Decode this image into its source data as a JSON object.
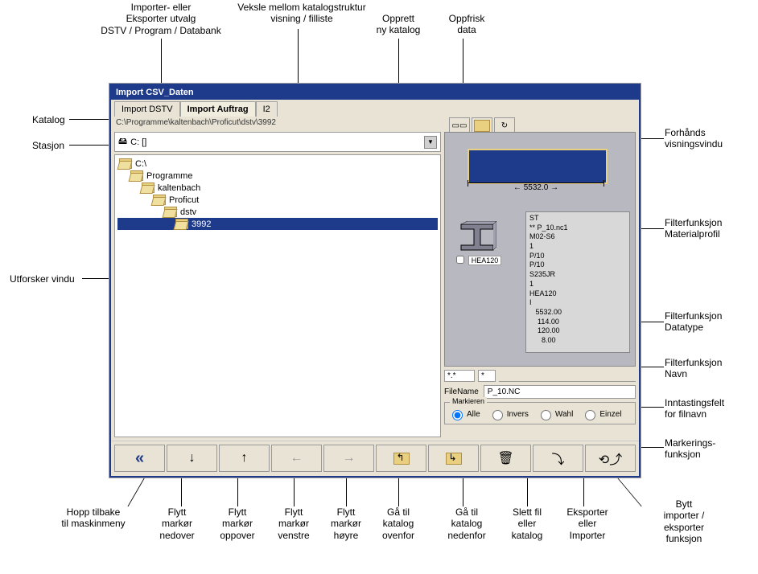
{
  "annotations": {
    "import_export": "Importer- eller\nEksporter utvalg\nDSTV / Program / Databank",
    "toggle_view": "Veksle mellom katalogstruktur\nvisning / filliste",
    "new_catalog": "Opprett\nny katalog",
    "refresh": "Oppfrisk\ndata",
    "katalog": "Katalog",
    "stasjon": "Stasjon",
    "explorer": "Utforsker vindu",
    "preview_window": "Forhånds\nvisningsvindu",
    "filter_material": "Filterfunksjon\nMaterialprofil",
    "filter_datatype": "Filterfunksjon\nDatatype",
    "filter_name": "Filterfunksjon\nNavn",
    "filename_field": "Inntastingsfelt\nfor filnavn",
    "mark_func": "Markerings-\nfunksjon",
    "back_menu": "Hopp tilbake\ntil maskinmeny",
    "cursor_down": "Flytt\nmarkør\nnedover",
    "cursor_up": "Flytt\nmarkør\noppover",
    "cursor_left": "Flytt\nmarkør\nvenstre",
    "cursor_right": "Flytt\nmarkør\nhøyre",
    "cat_above": "Gå til\nkatalog\novenfor",
    "cat_below": "Gå til\nkatalog\nnedenfor",
    "delete": "Slett fil\neller\nkatalog",
    "export_import": "Eksporter\neller\nImporter",
    "switch_func": "Bytt\nimporter /\neksporter\nfunksjon"
  },
  "window": {
    "title": "Import  CSV_Daten",
    "tabs": [
      {
        "label": "Import DSTV"
      },
      {
        "label": "Import Auftrag"
      },
      {
        "label": "I2"
      }
    ],
    "path": "C:\\Programme\\kaltenbach\\Proficut\\dstv\\3992",
    "drive": "C: []",
    "tree": [
      {
        "label": "C:\\",
        "indent": 0
      },
      {
        "label": "Programme",
        "indent": 1
      },
      {
        "label": "kaltenbach",
        "indent": 2
      },
      {
        "label": "Proficut",
        "indent": 3
      },
      {
        "label": "dstv",
        "indent": 4
      },
      {
        "label": "3992",
        "indent": 5,
        "selected": true
      }
    ],
    "preview": {
      "dimension": "5532.0",
      "profile_label": "HEA120",
      "data_lines": [
        "ST",
        "** P_10.nc1",
        "M02-S6",
        "1",
        "P/10",
        "P/10",
        "S235JR",
        "1",
        "HEA120",
        "I",
        "   5532.00",
        "    114.00",
        "    120.00",
        "      8.00"
      ]
    },
    "filter": {
      "pattern": "*.*",
      "type_pattern": "*"
    },
    "filename": {
      "label": "FileName",
      "value": "P_10.NC"
    },
    "mark": {
      "legend": "Markieren",
      "options": [
        "Alle",
        "Invers",
        "Wahl",
        "Einzel"
      ]
    }
  }
}
